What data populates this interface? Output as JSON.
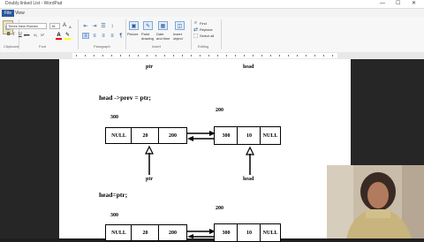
{
  "window": {
    "title": "Doubly linked List - WordPad",
    "minimize": "—",
    "maximize": "☐",
    "close": "✕"
  },
  "menu": {
    "file_tab": "File",
    "view_tab": "View"
  },
  "ribbon": {
    "font_name": "Times New Roman",
    "font_size": "16",
    "groups": {
      "clipboard": "Clipboard",
      "font": "Font",
      "paragraph": "Paragraph",
      "insert": "Insert",
      "editing": "Editing"
    },
    "buttons": {
      "paste": "Paste",
      "picture": "Picture",
      "paint_drawing": "Paint drawing",
      "date_time": "Date and time",
      "insert_object": "Insert object",
      "find": "Find",
      "replace": "Replace",
      "select_all": "Select all"
    },
    "format": {
      "bold": "B",
      "italic": "I",
      "underline": "U",
      "strike": "abc",
      "subscript": "X₂",
      "superscript": "X²",
      "grow": "A",
      "shrink": "A"
    }
  },
  "document": {
    "top_label_ptr": "ptr",
    "top_label_head": "head",
    "statement1": "head ->prev = ptr;",
    "statement2": "head=ptr;",
    "diagram1": {
      "left_addr": "300",
      "right_addr": "200",
      "left_node": [
        "NULL",
        "20",
        "200"
      ],
      "right_node": [
        "300",
        "10",
        "NULL"
      ],
      "left_pointer": "ptr",
      "right_pointer": "head"
    },
    "diagram2": {
      "left_addr": "300",
      "right_addr": "200",
      "left_node": [
        "NULL",
        "20",
        "200"
      ],
      "right_node": [
        "300",
        "10",
        "NULL"
      ]
    }
  },
  "colors": {
    "accent": "#2b579a",
    "page": "#ffffff",
    "workspace": "#262626"
  }
}
